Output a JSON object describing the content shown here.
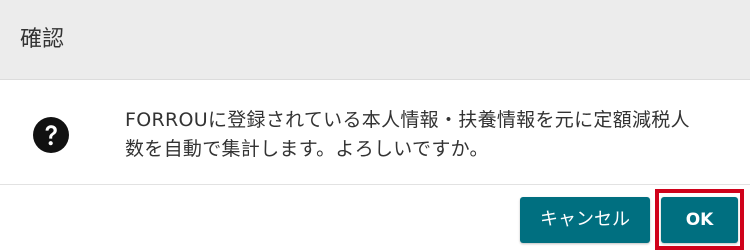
{
  "dialog": {
    "title": "確認",
    "message_line1": "FORROUに登録されている本人情報・扶養情報を元に定額減税人",
    "message_line2": "数を自動で集計します。よろしいですか。",
    "icon": "question-circle-icon"
  },
  "buttons": {
    "cancel_label": "キャンセル",
    "ok_label": "OK"
  },
  "colors": {
    "header_bg": "#ececec",
    "button_bg": "#006f80",
    "highlight_border": "#d0021b",
    "icon": "#111111"
  }
}
